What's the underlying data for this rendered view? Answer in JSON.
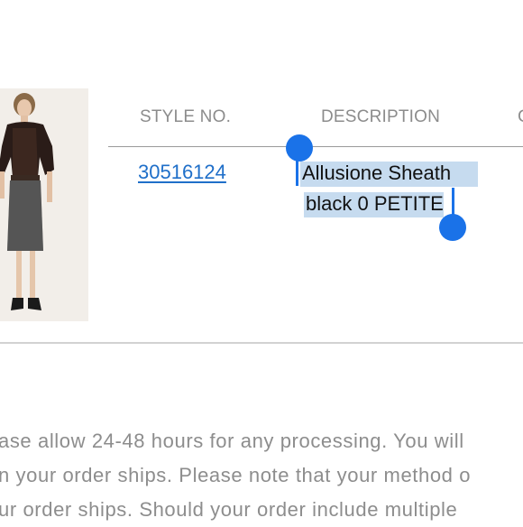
{
  "table": {
    "headers": {
      "style_no": "STYLE NO.",
      "description": "DESCRIPTION",
      "next_partial": "C"
    },
    "row": {
      "style_no": "30516124",
      "description_line1": "Allusione Sheath",
      "description_line2": "black 0 PETITE"
    }
  },
  "notice": {
    "lines": [
      "ase allow 24-48 hours for any processing. You will",
      "n your order ships. Please note that your method o",
      "ur order ships. Should your order include multiple"
    ]
  },
  "colors": {
    "link": "#1f6fc9",
    "selection_highlight": "#c6dbef",
    "selection_handle": "#1a72e8",
    "muted_text": "#8d8d8d"
  },
  "icons": {
    "selection_start": "text-selection-start-handle",
    "selection_end": "text-selection-end-handle"
  }
}
